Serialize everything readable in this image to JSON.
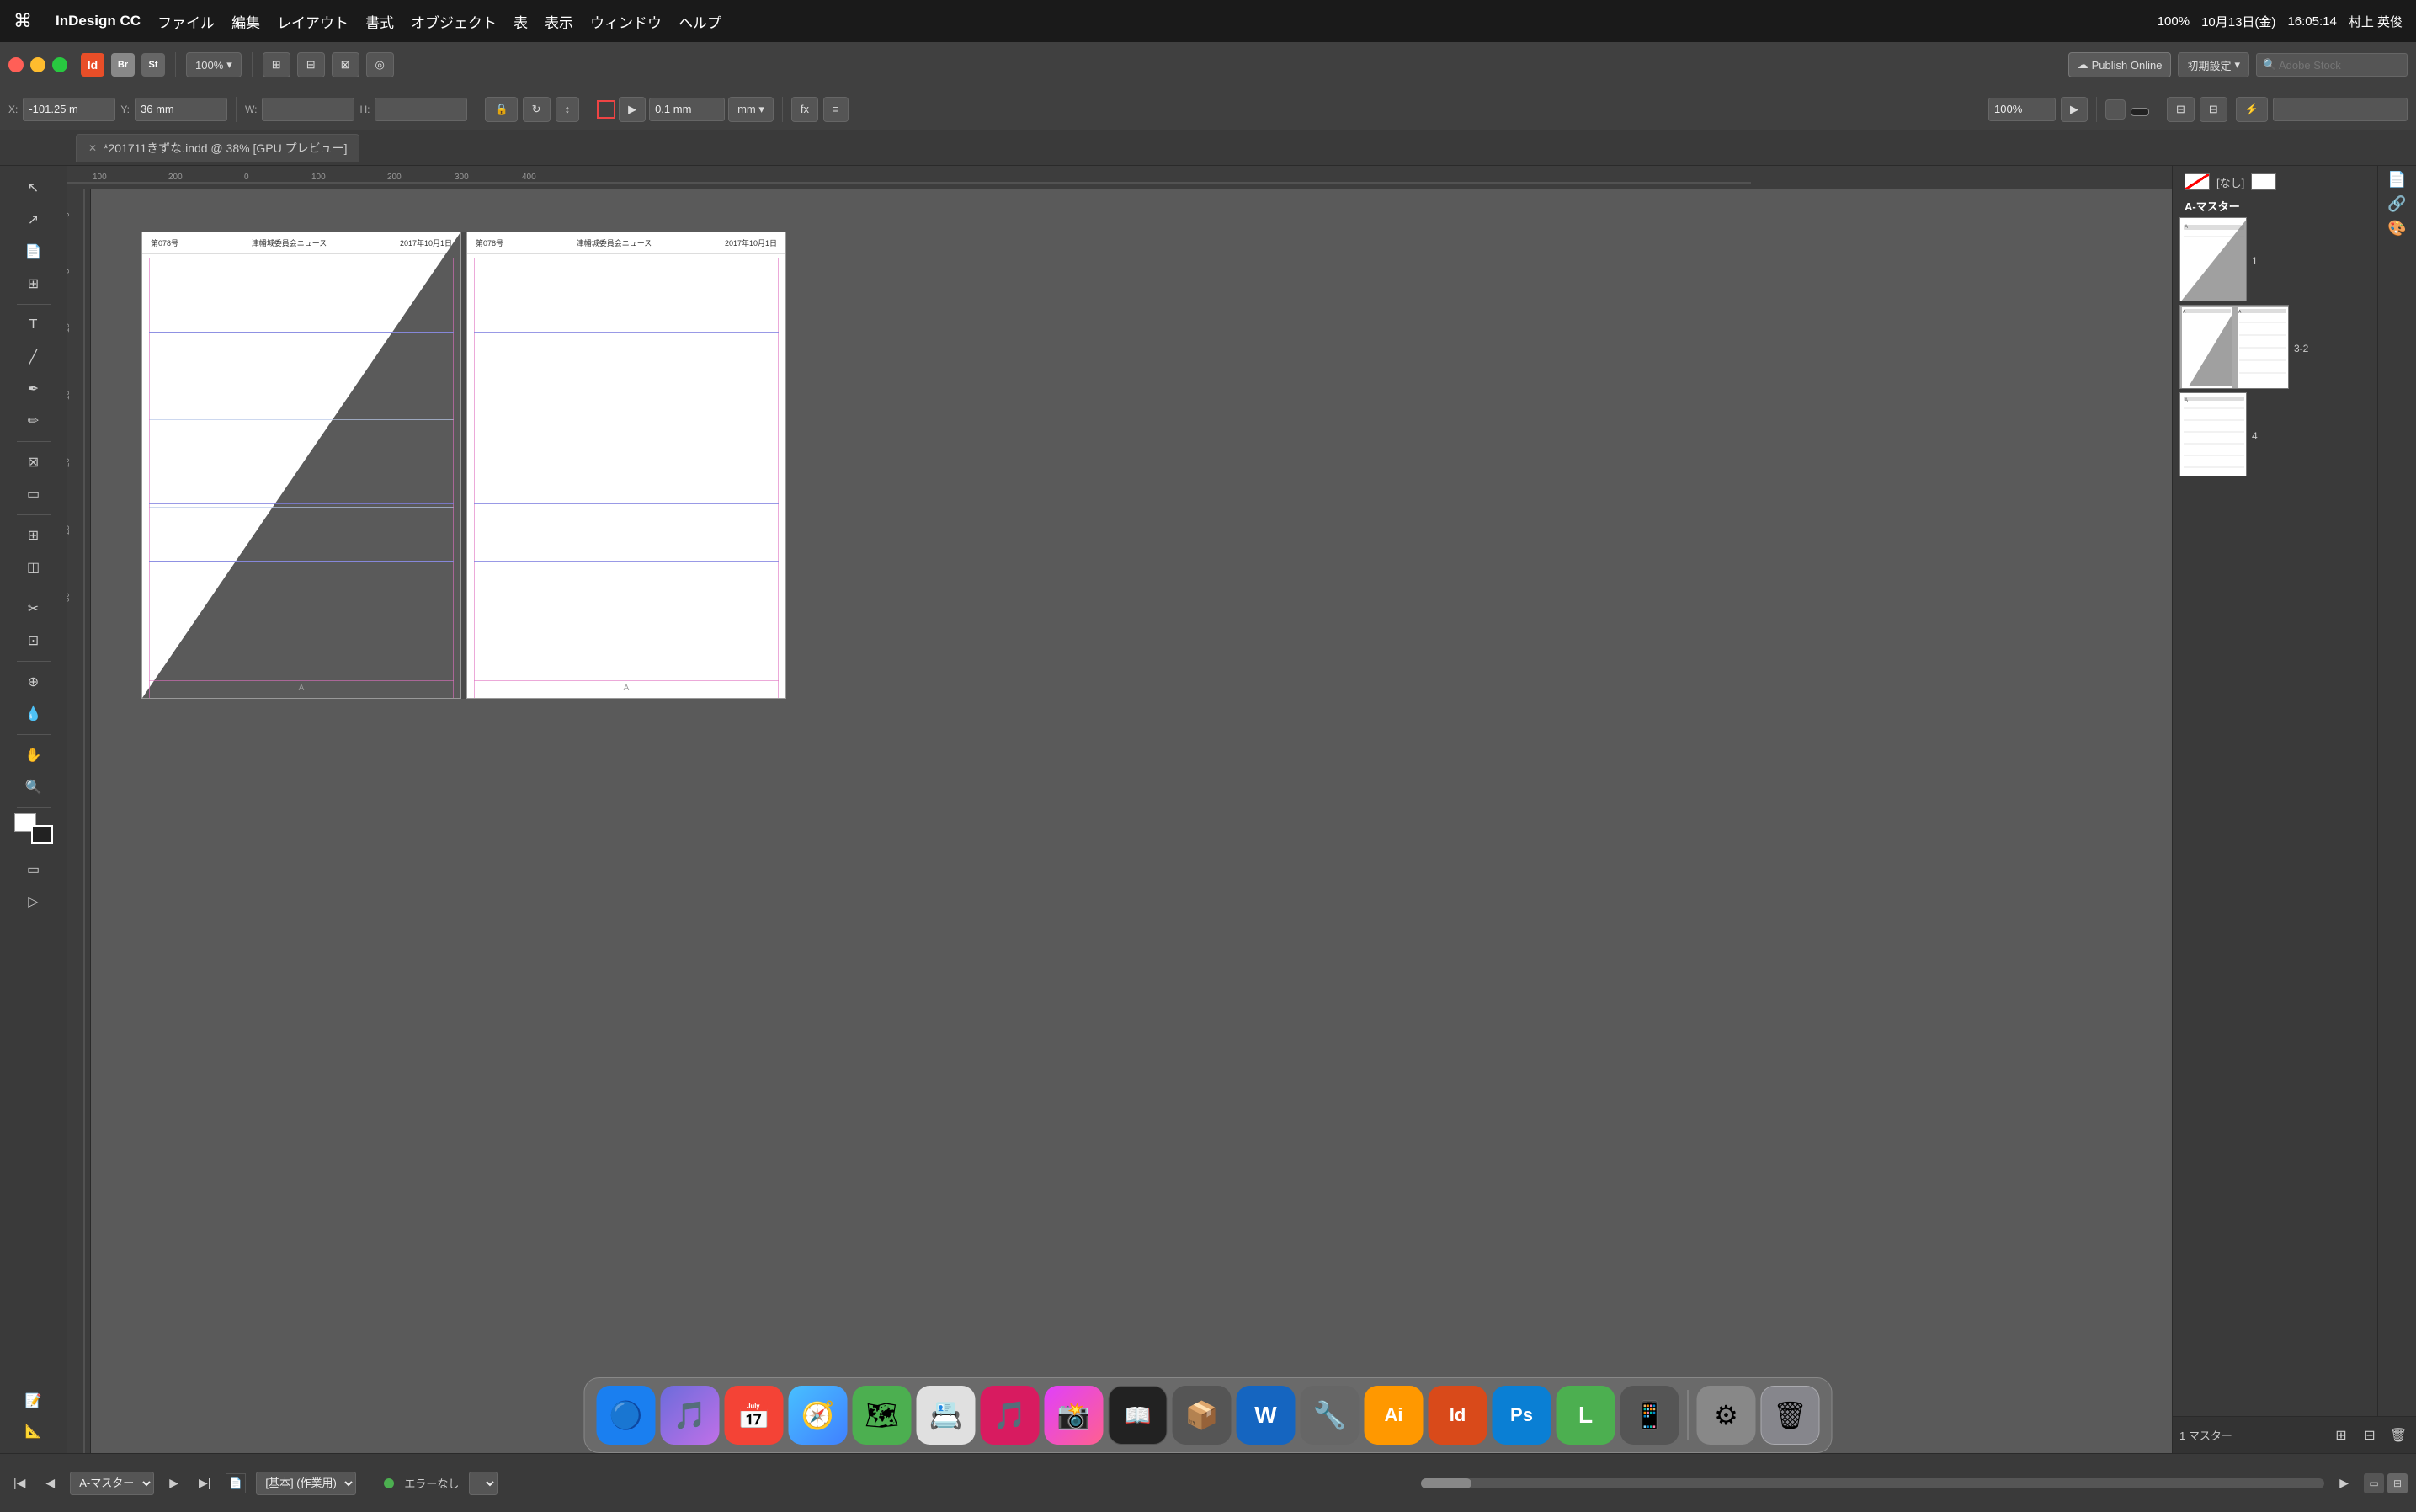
{
  "app": {
    "name": "InDesign CC",
    "title": "*201711きずな.indd @ 38% [GPU プレビュー]",
    "zoom": "37.7%",
    "publish_btn": "Publish Online",
    "settings_btn": "初期設定",
    "search_placeholder": "Adobe Stock"
  },
  "menubar": {
    "apple": "⌘",
    "items": [
      "InDesign CC",
      "ファイル",
      "編集",
      "レイアウト",
      "書式",
      "オブジェクト",
      "表",
      "表示",
      "ウィンドウ",
      "ヘルプ"
    ],
    "right": {
      "battery": "100%",
      "time": "16:05:14",
      "date": "10月13日(金)",
      "user": "村上 英俊"
    }
  },
  "toolbar": {
    "x_label": "X:",
    "x_value": "-101.25 m",
    "y_label": "Y:",
    "y_value": "36 mm",
    "w_label": "W:",
    "h_label": "H:",
    "stroke_value": "0.1 mm",
    "zoom_value": "100%"
  },
  "tabbar": {
    "tab_label": "*201711きずな.indd @ 38% [GPU プレビュー]"
  },
  "pages_panel": {
    "tab_pages": "ページ",
    "tab_links": "リンク",
    "none_label": "[なし]",
    "master_label": "A-マスター",
    "page_1_label": "1",
    "page_32_label": "3-2",
    "page_4_label": "4",
    "master_count": "1 マスター"
  },
  "document": {
    "left_page": {
      "issue": "第078号",
      "title": "津幡城委員会ニュース",
      "date": "2017年10月1日",
      "footer": "A"
    },
    "right_page": {
      "issue": "第078号",
      "title": "津幡城委員会ニュース",
      "date": "2017年10月1日",
      "footer": "A"
    }
  },
  "statusbar": {
    "page_dropdown": "A-マスター",
    "style_dropdown": "[基本] (作業用)",
    "error_status": "エラーなし"
  },
  "dock": {
    "items": [
      {
        "name": "finder",
        "label": "Finder",
        "color": "#1a7ff0",
        "symbol": "🔍"
      },
      {
        "name": "siri",
        "label": "Siri",
        "color": "#6c6cdb",
        "symbol": "🎵"
      },
      {
        "name": "calendar",
        "label": "Calendar",
        "color": "#f44336",
        "symbol": "📅"
      },
      {
        "name": "safari",
        "label": "Safari",
        "color": "#2196F3",
        "symbol": "🧭"
      },
      {
        "name": "maps",
        "label": "Maps",
        "color": "#4caf50",
        "symbol": "🗺"
      },
      {
        "name": "contacts",
        "label": "Contacts",
        "color": "#888",
        "symbol": "📇"
      },
      {
        "name": "itunes",
        "label": "iTunes",
        "color": "#d81b60",
        "symbol": "🎵"
      },
      {
        "name": "photos",
        "label": "Photos",
        "color": "#e91e63",
        "symbol": "📸"
      },
      {
        "name": "kindle",
        "label": "Kindle",
        "color": "#333",
        "symbol": "📖"
      },
      {
        "name": "spare1",
        "label": "",
        "color": "#666",
        "symbol": "📦"
      },
      {
        "name": "word",
        "label": "Word",
        "color": "#1565c0",
        "symbol": "W"
      },
      {
        "name": "spare2",
        "label": "",
        "color": "#888",
        "symbol": "🔧"
      },
      {
        "name": "illustrator",
        "label": "Illustrator",
        "color": "#ff9800",
        "symbol": "Ai"
      },
      {
        "name": "indesign",
        "label": "InDesign",
        "color": "#d94a1a",
        "symbol": "Id"
      },
      {
        "name": "photoshop",
        "label": "Photoshop",
        "color": "#1565c0",
        "symbol": "Ps"
      },
      {
        "name": "line",
        "label": "LINE",
        "color": "#4caf50",
        "symbol": "L"
      },
      {
        "name": "spare3",
        "label": "",
        "color": "#555",
        "symbol": "📱"
      },
      {
        "name": "systemprefs",
        "label": "System Preferences",
        "color": "#888",
        "symbol": "⚙"
      },
      {
        "name": "trash",
        "label": "Trash",
        "color": "#888",
        "symbol": "🗑"
      }
    ]
  },
  "icons": {
    "arrow": "▶",
    "chevron_right": "›",
    "chevron_left": "‹",
    "chevron_down": "▾",
    "close": "✕",
    "menu": "≡",
    "add": "+",
    "delete": "🗑",
    "duplicate": "⊞",
    "move_page": "↕"
  }
}
